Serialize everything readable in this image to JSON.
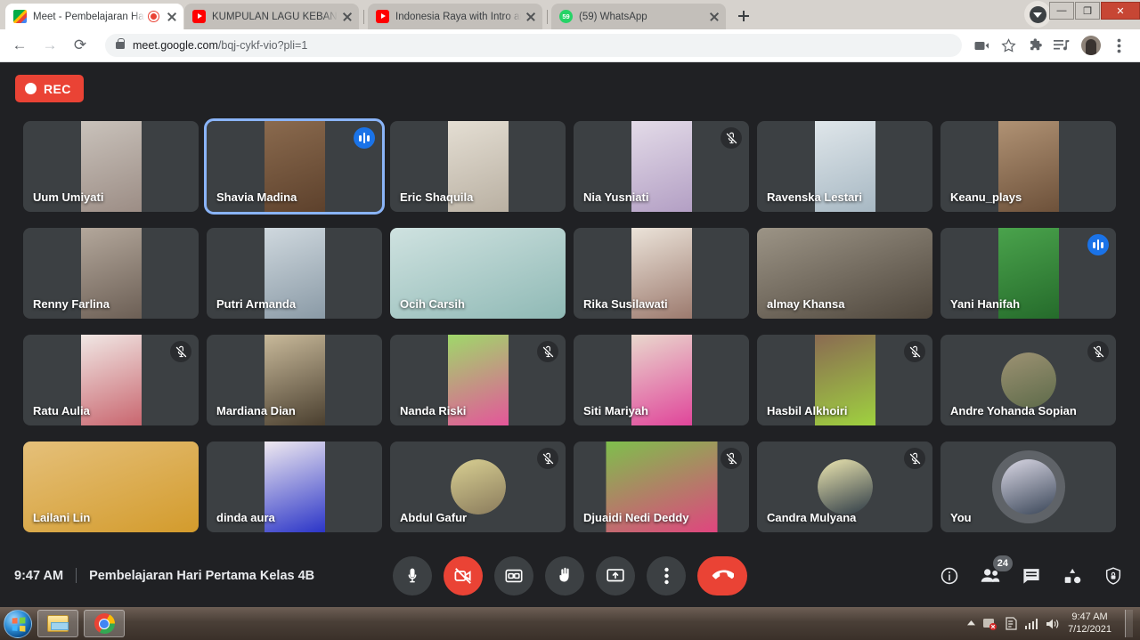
{
  "browser": {
    "tabs": [
      {
        "title": "Meet - Pembelajaran Hari Pe",
        "favicon": "meet-icon",
        "active": true,
        "recording": true
      },
      {
        "title": "KUMPULAN LAGU KEBANGSAAN",
        "favicon": "youtube-icon",
        "active": false,
        "recording": false
      },
      {
        "title": "Indonesia Raya with Intro and Te",
        "favicon": "youtube-icon",
        "active": false,
        "recording": false
      },
      {
        "title": "(59) WhatsApp",
        "favicon": "whatsapp-icon",
        "badge": "59",
        "active": false,
        "recording": false
      }
    ],
    "new_tab_label": "+",
    "window_controls": {
      "minimize": "—",
      "maximize": "❐",
      "close": "✕"
    },
    "url_secure_prefix": "meet.google.com",
    "url_path": "/bqj-cykf-vio?pli=1",
    "back_label": "←",
    "forward_label": "→",
    "reload_label": "⟳"
  },
  "meet": {
    "recording_badge": "REC",
    "time": "9:47 AM",
    "meeting_title": "Pembelajaran Hari Pertama Kelas 4B",
    "participant_count": "24",
    "participants": [
      {
        "name": "Uum Umiyati",
        "video": "portrait",
        "muted": false,
        "speaking": false,
        "highlight": false,
        "bg1": "#c9c2bb",
        "bg2": "#9c8d85"
      },
      {
        "name": "Shavia Madina",
        "video": "portrait",
        "muted": false,
        "speaking": true,
        "highlight": true,
        "bg1": "#8a6a4e",
        "bg2": "#5d412c"
      },
      {
        "name": "Eric Shaquila",
        "video": "portrait",
        "muted": false,
        "speaking": false,
        "highlight": false,
        "bg1": "#e4ded3",
        "bg2": "#b9b0a2"
      },
      {
        "name": "Nia Yusniati",
        "video": "portrait",
        "muted": true,
        "speaking": false,
        "highlight": false,
        "bg1": "#e3dbe8",
        "bg2": "#b39fc4"
      },
      {
        "name": "Ravenska Lestari",
        "video": "portrait",
        "muted": false,
        "speaking": false,
        "highlight": false,
        "bg1": "#dfe6ea",
        "bg2": "#a7b8c3"
      },
      {
        "name": "Keanu_plays",
        "video": "portrait",
        "muted": false,
        "speaking": false,
        "highlight": false,
        "bg1": "#b09274",
        "bg2": "#6d513a"
      },
      {
        "name": "Renny Farlina",
        "video": "portrait",
        "muted": false,
        "speaking": false,
        "highlight": false,
        "bg1": "#b3a79b",
        "bg2": "#6c5f55"
      },
      {
        "name": "Putri Armanda",
        "video": "portrait",
        "muted": false,
        "speaking": false,
        "highlight": false,
        "bg1": "#cfd8de",
        "bg2": "#8a9aa6"
      },
      {
        "name": "Ocih Carsih",
        "video": "full",
        "muted": false,
        "speaking": false,
        "highlight": false,
        "bg1": "#cfe2e0",
        "bg2": "#8fb9b5"
      },
      {
        "name": "Rika Susilawati",
        "video": "portrait",
        "muted": false,
        "speaking": false,
        "highlight": false,
        "bg1": "#ebe3d9",
        "bg2": "#9c7a6e"
      },
      {
        "name": "almay Khansa",
        "video": "full",
        "muted": false,
        "speaking": false,
        "highlight": false,
        "bg1": "#9c9486",
        "bg2": "#4e463c"
      },
      {
        "name": "Yani Hanifah",
        "video": "portrait",
        "muted": false,
        "speaking": true,
        "highlight": false,
        "bg1": "#4aa34c",
        "bg2": "#256b2b"
      },
      {
        "name": "Ratu Aulia",
        "video": "portrait",
        "muted": true,
        "speaking": false,
        "highlight": false,
        "bg1": "#f0e7e4",
        "bg2": "#c9666f"
      },
      {
        "name": "Mardiana Dian",
        "video": "portrait",
        "muted": false,
        "speaking": false,
        "highlight": false,
        "bg1": "#c8b99a",
        "bg2": "#4a3f2f"
      },
      {
        "name": "Nanda Riski",
        "video": "portrait",
        "muted": true,
        "speaking": false,
        "highlight": false,
        "bg1": "#9fd86a",
        "bg2": "#e4569a"
      },
      {
        "name": "Siti Mariyah",
        "video": "portrait",
        "muted": false,
        "speaking": false,
        "highlight": false,
        "bg1": "#e9d8cd",
        "bg2": "#e0459a"
      },
      {
        "name": "Hasbil Alkhoiri",
        "video": "portrait",
        "muted": true,
        "speaking": false,
        "highlight": false,
        "bg1": "#8a6a52",
        "bg2": "#9fd23f"
      },
      {
        "name": "Andre Yohanda Sopian",
        "video": "avatar",
        "muted": true,
        "speaking": false,
        "highlight": false,
        "bg1": "#9d9273",
        "bg2": "#5e6b4a"
      },
      {
        "name": "Lailani Lin",
        "video": "full",
        "muted": false,
        "speaking": false,
        "highlight": false,
        "bg1": "#e5c07a",
        "bg2": "#d39b2c"
      },
      {
        "name": "dinda aura",
        "video": "portrait",
        "muted": false,
        "speaking": false,
        "highlight": false,
        "bg1": "#efe9f0",
        "bg2": "#2b35c8"
      },
      {
        "name": "Abdul Gafur",
        "video": "avatar",
        "muted": true,
        "speaking": false,
        "highlight": false,
        "bg1": "#d8cf92",
        "bg2": "#8a7b5c"
      },
      {
        "name": "Djuaidi Nedi Deddy",
        "video": "wide",
        "muted": true,
        "speaking": false,
        "highlight": false,
        "bg1": "#7ebf4c",
        "bg2": "#e0457f"
      },
      {
        "name": "Candra Mulyana",
        "video": "avatar",
        "muted": true,
        "speaking": false,
        "highlight": false,
        "bg1": "#ece6b0",
        "bg2": "#2d3a46"
      },
      {
        "name": "You",
        "video": "you",
        "muted": false,
        "speaking": false,
        "highlight": false,
        "bg1": "#d9d7e4",
        "bg2": "#3a4658"
      }
    ],
    "controls": [
      {
        "name": "microphone",
        "label": "Turn off microphone",
        "state": "on"
      },
      {
        "name": "camera",
        "label": "Turn on camera",
        "state": "off"
      },
      {
        "name": "captions",
        "label": "Turn on captions",
        "state": "on"
      },
      {
        "name": "raise-hand",
        "label": "Raise hand",
        "state": "on"
      },
      {
        "name": "present",
        "label": "Present now",
        "state": "on"
      },
      {
        "name": "more",
        "label": "More options",
        "state": "on"
      },
      {
        "name": "hangup",
        "label": "Leave call",
        "state": "danger"
      }
    ],
    "right_controls": [
      {
        "name": "meeting-details",
        "label": "Meeting details"
      },
      {
        "name": "people",
        "label": "Show everyone"
      },
      {
        "name": "chat",
        "label": "Chat with everyone"
      },
      {
        "name": "activities",
        "label": "Activities"
      },
      {
        "name": "host-controls",
        "label": "Host controls"
      }
    ],
    "accent_blue": "#8ab4f8",
    "danger_red": "#ea4335"
  },
  "taskbar": {
    "items": [
      {
        "name": "start-orb",
        "label": "Start"
      },
      {
        "name": "file-explorer",
        "label": "Windows Explorer"
      },
      {
        "name": "chrome",
        "label": "Google Chrome"
      }
    ],
    "clock_time": "9:47 AM",
    "clock_date": "7/12/2021"
  }
}
